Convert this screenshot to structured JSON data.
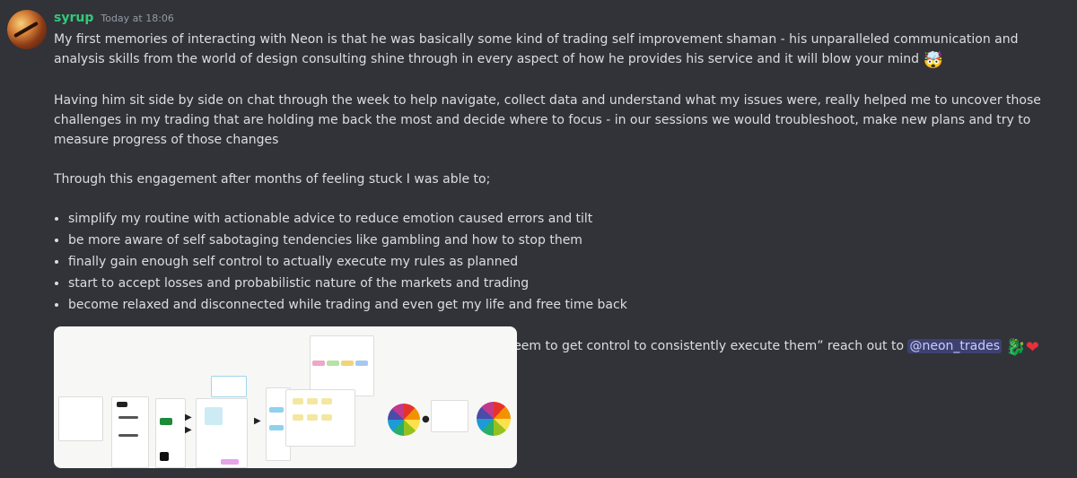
{
  "message": {
    "username": "syrup",
    "timestamp": "Today at 18:06",
    "paragraph1": "My first memories of interacting with Neon is that he was basically some kind of trading self improvement shaman - his unparalleled communication and analysis skills from the world of design consulting shine through in every aspect of how he provides his service and it will blow your mind",
    "paragraph2": "Having him sit side by side on chat through the week to help navigate, collect data and understand what my issues were, really helped me to uncover those challenges in my trading that are holding me back the most and decide where to focus - in our sessions we would troubleshoot, make new plans and try to measure progress of those changes",
    "paragraph3": "Through this engagement after months of feeling stuck I was able to;",
    "bullets": [
      "simplify my routine with actionable advice to reduce emotion caused errors and tilt",
      "be more aware of self sabotaging tendencies like gambling and how to stop them",
      "finally gain enough self control to actually execute my rules as planned",
      "start to accept losses and probabilistic nature of the markets and trading",
      "become relaxed and disconnected while trading and even get my life and free time back"
    ],
    "closing": "If you find yourself feeling like I did, “seeing all the setups but just cant seem to get control to consistently execute them” reach out to",
    "mention": "@neon_trades",
    "emoji_mind_blown": "🤯",
    "emoji_dragon": "🐉",
    "emoji_heart": "❤",
    "attachment_icon": "image-attachment-icon"
  }
}
